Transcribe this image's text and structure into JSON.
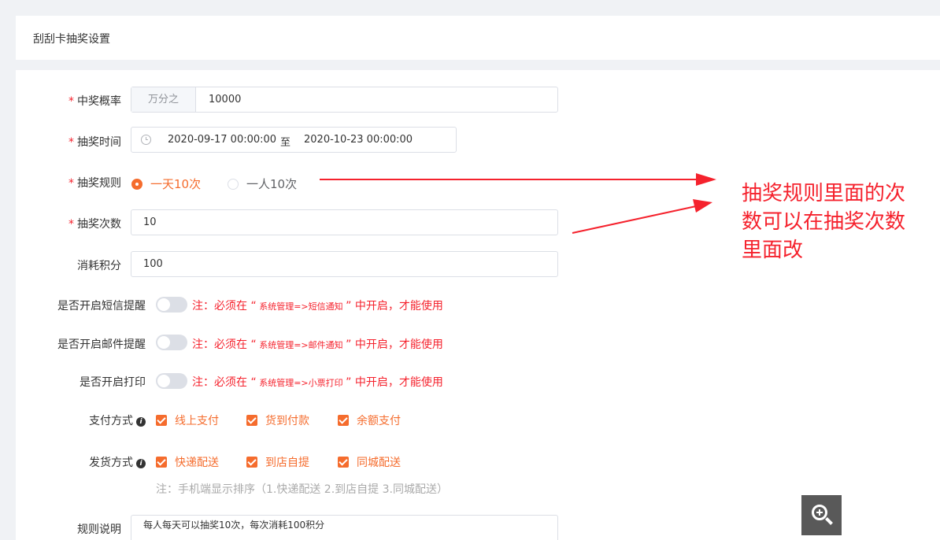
{
  "header": {
    "title": "刮刮卡抽奖设置"
  },
  "form": {
    "probability": {
      "label": "中奖概率",
      "addon": "万分之",
      "value": "10000"
    },
    "time": {
      "label": "抽奖时间",
      "start": "2020-09-17 00:00:00",
      "separator": "至",
      "end": "2020-10-23 00:00:00"
    },
    "rule": {
      "label": "抽奖规则",
      "options": [
        "一天10次",
        "一人10次"
      ],
      "selected": "一天10次"
    },
    "count": {
      "label": "抽奖次数",
      "value": "10"
    },
    "points": {
      "label": "消耗积分",
      "value": "100"
    },
    "sms": {
      "label": "是否开启短信提醒",
      "enabled": false,
      "note_prefix": "注：必须在 “",
      "note_path": " 系统管理=>短信通知 ",
      "note_suffix": "” 中开启，才能使用"
    },
    "mail": {
      "label": "是否开启邮件提醒",
      "enabled": false,
      "note_prefix": "注：必须在 “",
      "note_path": " 系统管理=>邮件通知 ",
      "note_suffix": "” 中开启，才能使用"
    },
    "print": {
      "label": "是否开启打印",
      "enabled": false,
      "note_prefix": "注：必须在 “",
      "note_path": " 系统管理=>小票打印 ",
      "note_suffix": "” 中开启，才能使用"
    },
    "payment": {
      "label": "支付方式",
      "options": [
        "线上支付",
        "货到付款",
        "余额支付"
      ]
    },
    "delivery": {
      "label": "发货方式",
      "options": [
        "快递配送",
        "到店自提",
        "同城配送"
      ],
      "hint": "注：手机端显示排序（1.快递配送 2.到店自提 3.同城配送）"
    },
    "description": {
      "label": "规则说明",
      "value": "每人每天可以抽奖10次，每次消耗100积分"
    }
  },
  "annotation": {
    "text": "抽奖规则里面的次数可以在抽奖次数里面改",
    "color": "#f5222d"
  },
  "colors": {
    "accent": "#f56c2d",
    "required": "#f5222d"
  },
  "icons": {
    "zoom": "zoom-in-icon",
    "clock": "clock-icon",
    "info": "info-icon"
  }
}
